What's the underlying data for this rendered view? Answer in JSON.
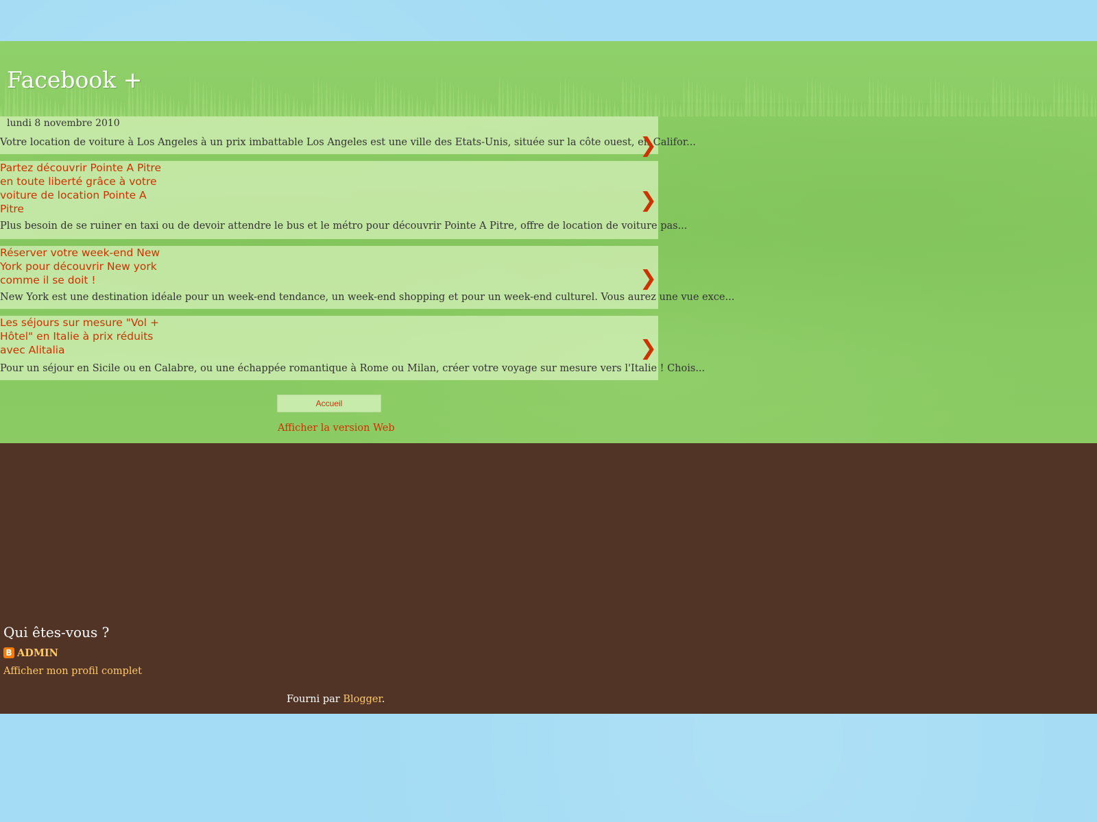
{
  "blog": {
    "title": "Facebook +"
  },
  "posts": [
    {
      "date": "lundi 8 novembre 2010",
      "title": "",
      "snippet": "Votre location de voiture à Los Angeles à un prix imbattable Los Angeles est une ville des Etats-Unis, située sur la côte ouest, en Califor...",
      "arrow": "❯"
    },
    {
      "title": "Partez découvrir Pointe A Pitre en toute liberté grâce à votre voiture de location Pointe A Pitre",
      "snippet": "Plus besoin de se ruiner en taxi ou de devoir attendre le bus et le métro pour découvrir Pointe A Pitre,  offre de location de voiture pas...",
      "arrow": "❯"
    },
    {
      "title": "Réserver votre week-end New York pour découvrir New york comme il se doit !",
      "snippet": "New York  est une destination idéale pour un week-end tendance, un week-end shopping et pour un week-end culturel. Vous aurez une vue exce...",
      "arrow": "❯"
    },
    {
      "title": "Les séjours sur mesure \"Vol + Hôtel\" en Italie à prix réduits avec Alitalia",
      "snippet": "Pour un séjour en Sicile ou en Calabre, ou une échappée romantique à Rome ou Milan, créer votre voyage sur mesure vers l'Italie ! Chois...",
      "arrow": "❯"
    }
  ],
  "nav": {
    "home_label": "Accueil",
    "web_version_label": "Afficher la version Web"
  },
  "about": {
    "title": "Qui êtes-vous ?",
    "icon": "blogger-icon",
    "name": "ADMIN",
    "profile_link": "Afficher mon profil complet"
  },
  "footer": {
    "powered_prefix": "Fourni par ",
    "powered_link": "Blogger",
    "powered_suffix": "."
  },
  "colors": {
    "sky": "#a3dcf4",
    "grass": "#8ccd66",
    "ground": "#523426",
    "link": "#cc3300",
    "footer_link": "#ffc966"
  }
}
